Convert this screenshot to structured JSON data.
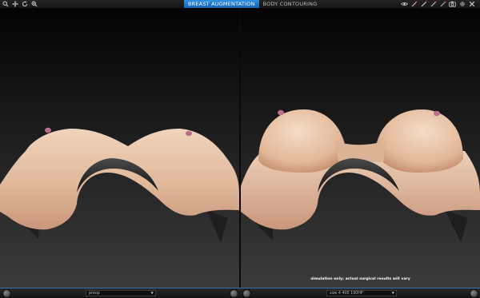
{
  "toolbar": {
    "left_tools": [
      {
        "icon": "zoom-icon"
      },
      {
        "icon": "move-icon"
      },
      {
        "icon": "rotate-icon"
      },
      {
        "icon": "zoom-in-icon"
      }
    ],
    "right_tools": [
      {
        "icon": "eye-icon"
      },
      {
        "icon": "measure-tool-icon"
      },
      {
        "icon": "marker-tool-icon"
      },
      {
        "icon": "brush-tool-icon"
      },
      {
        "icon": "pen-tool-icon"
      },
      {
        "icon": "camera-icon"
      },
      {
        "icon": "settings-icon"
      },
      {
        "icon": "close-icon"
      }
    ]
  },
  "mode_tabs": [
    {
      "label": "BREAST AUGMENTATION",
      "active": true
    },
    {
      "label": "BODY CONTOURING",
      "active": false
    }
  ],
  "left_view": {
    "selector_label": "preop"
  },
  "right_view": {
    "selector_label": "size 4 400 190HP",
    "disclaimer": "simulation only; actual surgical results will vary"
  },
  "colors": {
    "accent": "#1e7fd6",
    "skin": "#e7c4a9",
    "nipple": "#b9708a",
    "cavity": "#2b2b2b"
  }
}
